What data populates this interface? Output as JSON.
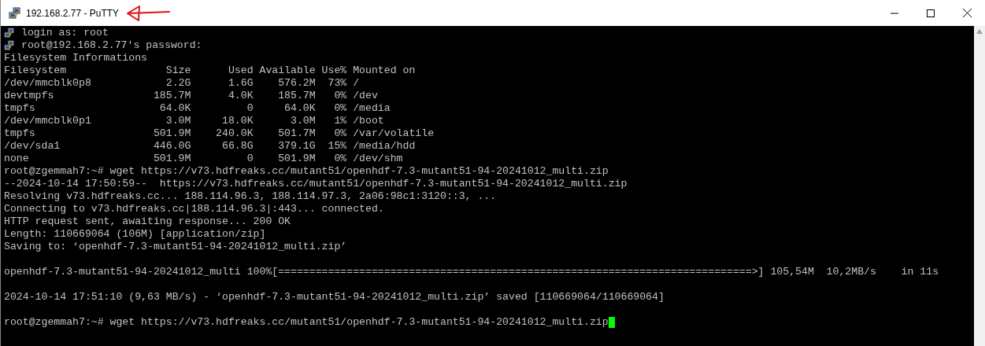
{
  "window": {
    "title": "192.168.2.77 - PuTTY"
  },
  "terminal": {
    "lines": [
      {
        "kind": "login",
        "text": "login as: root"
      },
      {
        "kind": "login",
        "text": "root@192.168.2.77's password:"
      },
      {
        "kind": "text",
        "text": "Filesystem Informations"
      },
      {
        "kind": "text",
        "text": "Filesystem                Size      Used Available Use% Mounted on"
      },
      {
        "kind": "text",
        "text": "/dev/mmcblk0p8            2.2G      1.6G    576.2M  73% /"
      },
      {
        "kind": "text",
        "text": "devtmpfs                185.7M      4.0K    185.7M   0% /dev"
      },
      {
        "kind": "text",
        "text": "tmpfs                    64.0K         0     64.0K   0% /media"
      },
      {
        "kind": "text",
        "text": "/dev/mmcblk0p1            3.0M     18.0K      3.0M   1% /boot"
      },
      {
        "kind": "text",
        "text": "tmpfs                   501.9M    240.0K    501.7M   0% /var/volatile"
      },
      {
        "kind": "text",
        "text": "/dev/sda1               446.0G     66.8G    379.1G  15% /media/hdd"
      },
      {
        "kind": "text",
        "text": "none                    501.9M         0    501.9M   0% /dev/shm"
      },
      {
        "kind": "text",
        "text": "root@zgemmah7:~# wget https://v73.hdfreaks.cc/mutant51/openhdf-7.3-mutant51-94-20241012_multi.zip"
      },
      {
        "kind": "text",
        "text": "--2024-10-14 17:50:59--  https://v73.hdfreaks.cc/mutant51/openhdf-7.3-mutant51-94-20241012_multi.zip"
      },
      {
        "kind": "text",
        "text": "Resolving v73.hdfreaks.cc... 188.114.96.3, 188.114.97.3, 2a06:98c1:3120::3, ..."
      },
      {
        "kind": "text",
        "text": "Connecting to v73.hdfreaks.cc|188.114.96.3|:443... connected."
      },
      {
        "kind": "text",
        "text": "HTTP request sent, awaiting response... 200 OK"
      },
      {
        "kind": "text",
        "text": "Length: 110669064 (106M) [application/zip]"
      },
      {
        "kind": "text",
        "text": "Saving to: ‘openhdf-7.3-mutant51-94-20241012_multi.zip’"
      },
      {
        "kind": "blank"
      },
      {
        "kind": "text",
        "text": "openhdf-7.3-mutant51-94-20241012_multi 100%[============================================================================>] 105,54M  10,2MB/s    in 11s"
      },
      {
        "kind": "blank"
      },
      {
        "kind": "text",
        "text": "2024-10-14 17:51:10 (9,63 MB/s) - ‘openhdf-7.3-mutant51-94-20241012_multi.zip’ saved [110669064/110669064]"
      },
      {
        "kind": "blank"
      },
      {
        "kind": "text",
        "text": "root@zgemmah7:~# wget https://v73.hdfreaks.cc/mutant51/openhdf-7.3-mutant51-94-20241012_multi.zip",
        "cursor": true
      }
    ]
  }
}
